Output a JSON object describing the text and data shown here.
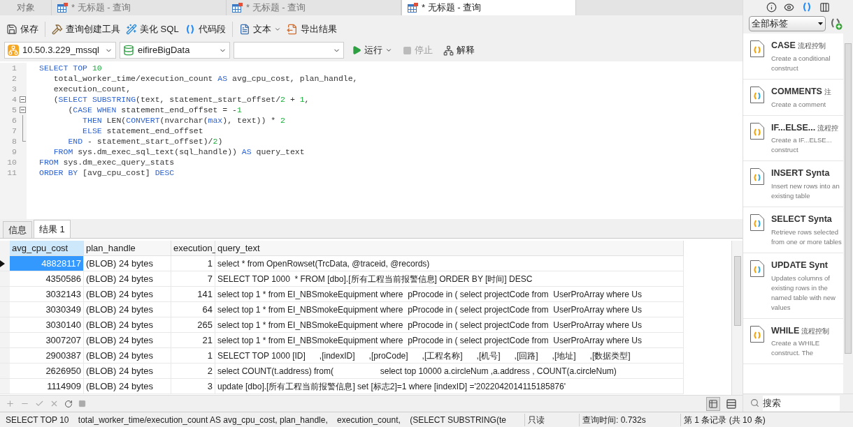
{
  "tabs": [
    {
      "label": "对象",
      "kind": "plain",
      "selected": false
    },
    {
      "label": "* 无标题 - 查询",
      "kind": "query",
      "selected": false
    },
    {
      "label": "* 无标题 - 查询",
      "kind": "query",
      "selected": false
    },
    {
      "label": "* 无标题 - 查询",
      "kind": "query",
      "selected": true
    }
  ],
  "toolbar": [
    {
      "label": "保存",
      "kind": "save"
    },
    {
      "label": "查询创建工具",
      "kind": "builder"
    },
    {
      "label": "美化 SQL",
      "kind": "beautify"
    },
    {
      "label": "代码段",
      "kind": "snippet"
    },
    {
      "label": "文本",
      "kind": "text"
    },
    {
      "label": "导出结果",
      "kind": "export"
    }
  ],
  "connection": {
    "server": "10.50.3.229_mssql",
    "database": "eifireBigData"
  },
  "actions": [
    {
      "label": "运行",
      "kind": "run",
      "disabled": false
    },
    {
      "label": "停止",
      "kind": "stop",
      "disabled": true
    },
    {
      "label": "解释",
      "kind": "explain",
      "disabled": false
    }
  ],
  "editor": {
    "lines": [
      {
        "number": "1",
        "kind": "plain",
        "tokens": [
          {
            "t": "SELECT TOP ",
            "kind": "keyword"
          },
          {
            "t": "10",
            "kind": "number"
          }
        ]
      },
      {
        "number": "2",
        "kind": "plain",
        "tokens": [
          {
            "t": "   total_worker_time/execution_count ",
            "kind": "plain"
          },
          {
            "t": "AS",
            "kind": "keyword"
          },
          {
            "t": " avg_cpu_cost, plan_handle,",
            "kind": "plain"
          }
        ]
      },
      {
        "number": "3",
        "kind": "plain",
        "tokens": [
          {
            "t": "   execution_count,",
            "kind": "plain"
          }
        ]
      },
      {
        "number": "4",
        "kind": "fold_start",
        "tokens": [
          {
            "t": "   (",
            "kind": "plain"
          },
          {
            "t": "SELECT SUBSTRING",
            "kind": "keyword"
          },
          {
            "t": "(text, statement_start_offset/",
            "kind": "plain"
          },
          {
            "t": "2",
            "kind": "number"
          },
          {
            "t": " + ",
            "kind": "plain"
          },
          {
            "t": "1",
            "kind": "number"
          },
          {
            "t": ",",
            "kind": "plain"
          }
        ]
      },
      {
        "number": "5",
        "kind": "fold_start",
        "tokens": [
          {
            "t": "      (",
            "kind": "plain"
          },
          {
            "t": "CASE WHEN",
            "kind": "keyword"
          },
          {
            "t": " statement_end_offset = -",
            "kind": "plain"
          },
          {
            "t": "1",
            "kind": "number"
          }
        ]
      },
      {
        "number": "6",
        "kind": "fold_inner",
        "tokens": [
          {
            "t": "         THEN",
            "kind": "keyword"
          },
          {
            "t": " LEN(",
            "kind": "plain"
          },
          {
            "t": "CONVERT",
            "kind": "keyword"
          },
          {
            "t": "(nvarchar(",
            "kind": "plain"
          },
          {
            "t": "max",
            "kind": "keyword"
          },
          {
            "t": "), text)) * ",
            "kind": "plain"
          },
          {
            "t": "2",
            "kind": "number"
          }
        ]
      },
      {
        "number": "7",
        "kind": "fold_inner",
        "tokens": [
          {
            "t": "         ELSE",
            "kind": "keyword"
          },
          {
            "t": " statement_end_offset",
            "kind": "plain"
          }
        ]
      },
      {
        "number": "8",
        "kind": "fold_end",
        "tokens": [
          {
            "t": "      END",
            "kind": "keyword"
          },
          {
            "t": " - statement_start_offset)/",
            "kind": "plain"
          },
          {
            "t": "2",
            "kind": "number"
          },
          {
            "t": ")",
            "kind": "plain"
          }
        ]
      },
      {
        "number": "9",
        "kind": "plain",
        "tokens": [
          {
            "t": "   FROM",
            "kind": "keyword"
          },
          {
            "t": " sys.dm_exec_sql_text(sql_handle)) ",
            "kind": "plain"
          },
          {
            "t": "AS",
            "kind": "keyword"
          },
          {
            "t": " query_text",
            "kind": "plain"
          }
        ]
      },
      {
        "number": "10",
        "kind": "plain",
        "tokens": [
          {
            "t": "FROM",
            "kind": "keyword"
          },
          {
            "t": " sys.dm_exec_query_stats",
            "kind": "plain"
          }
        ]
      },
      {
        "number": "11",
        "kind": "plain",
        "tokens": [
          {
            "t": "ORDER BY",
            "kind": "keyword"
          },
          {
            "t": " [avg_cpu_cost] ",
            "kind": "plain"
          },
          {
            "t": "DESC",
            "kind": "keyword"
          }
        ]
      }
    ]
  },
  "result_tabs": [
    {
      "label": "信息",
      "selected": false
    },
    {
      "label": "结果 1",
      "selected": true
    }
  ],
  "table": {
    "columns": [
      "avg_cpu_cost",
      "plan_handle",
      "execution_",
      "query_text"
    ],
    "rows": [
      {
        "selected": true,
        "cells": [
          "48828117",
          "(BLOB) 24 bytes",
          "1",
          "select * from OpenRowset(TrcData, @traceid, @records)"
        ]
      },
      {
        "selected": false,
        "cells": [
          "4350586",
          "(BLOB) 24 bytes",
          "7",
          "SELECT TOP 1000  * FROM [dbo].[所有工程当前报警信息] ORDER BY [时间] DESC"
        ]
      },
      {
        "selected": false,
        "cells": [
          "3032143",
          "(BLOB) 24 bytes",
          "141",
          "select top 1 * from EI_NBSmokeEquipment where  pProcode in ( select projectCode from  UserProArray where Us"
        ]
      },
      {
        "selected": false,
        "cells": [
          "3030349",
          "(BLOB) 24 bytes",
          "64",
          "select top 1 * from EI_NBSmokeEquipment where  pProcode in ( select projectCode from  UserProArray where Us"
        ]
      },
      {
        "selected": false,
        "cells": [
          "3030140",
          "(BLOB) 24 bytes",
          "265",
          "select top 1 * from EI_NBSmokeEquipment where  pProcode in ( select projectCode from  UserProArray where Us"
        ]
      },
      {
        "selected": false,
        "cells": [
          "3007207",
          "(BLOB) 24 bytes",
          "21",
          "select top 1 * from EI_NBSmokeEquipment where  pProcode in ( select projectCode from  UserProArray where Us"
        ]
      },
      {
        "selected": false,
        "cells": [
          "2900387",
          "(BLOB) 24 bytes",
          "1",
          "SELECT TOP 1000 [ID]      ,[indexID]      ,[proCode]      ,[工程名称]      ,[机号]      ,[回路]      ,[地址]      ,[数据类型]"
        ]
      },
      {
        "selected": false,
        "cells": [
          "2626950",
          "(BLOB) 24 bytes",
          "2",
          "select COUNT(t.address) from(                    select top 10000 a.circleNum ,a.address , COUNT(a.circleNum)"
        ]
      },
      {
        "selected": false,
        "cells": [
          "1114909",
          "(BLOB) 24 bytes",
          "3",
          "update [dbo].[所有工程当前报警信息] set [标志2]=1 where [indexID] ='2022042014115185876'"
        ]
      }
    ]
  },
  "side_panel": {
    "filter": "全部标签",
    "snippets": [
      {
        "title": "CASE",
        "tag": "流程控制",
        "desc": "Create a conditional construct",
        "kind": "flow"
      },
      {
        "title": "COMMENTS",
        "tag": "注",
        "desc": "Create a comment",
        "kind": "general"
      },
      {
        "title": "IF...ELSE...",
        "tag": "流程控",
        "desc": "Create a IF...ELSE... construct",
        "kind": "flow"
      },
      {
        "title": "INSERT Synta",
        "desc": "Insert new rows into an existing table",
        "kind": "general"
      },
      {
        "title": "SELECT Synta",
        "desc": "Retrieve rows selected from one or more tables",
        "kind": "general"
      },
      {
        "title": "UPDATE Synt",
        "desc": "Updates columns of existing rows in the named table with new values",
        "kind": "general"
      },
      {
        "title": "WHILE",
        "tag": "流程控制",
        "desc": "Create a WHILE construct. The",
        "kind": "flow"
      }
    ],
    "search_placeholder": "搜索"
  },
  "status_bar": {
    "sql": "SELECT TOP 10    total_worker_time/execution_count AS avg_cpu_cost, plan_handle,    execution_count,    (SELECT SUBSTRING(te",
    "mode": "只读",
    "time": "查询时间: 0.732s",
    "record": "第 1 条记录 (共 10 条)"
  }
}
